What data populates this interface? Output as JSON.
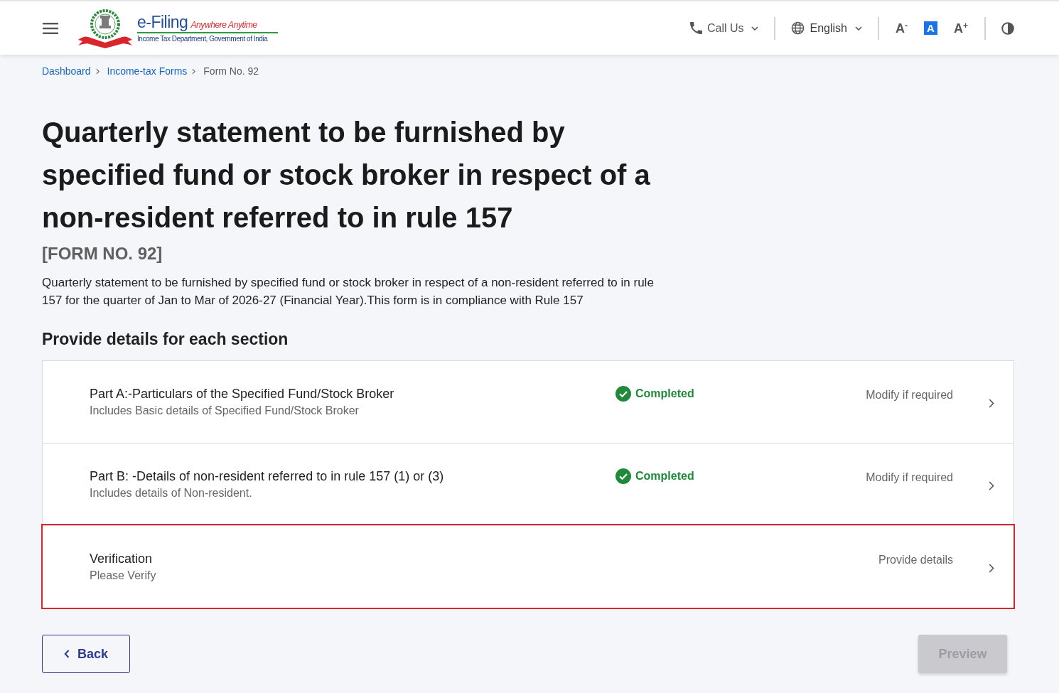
{
  "header": {
    "logo": {
      "title": "e-Filing",
      "tagline": "Anywhere Anytime",
      "subtitle": "Income Tax Department, Government of India"
    },
    "call_us": "Call Us",
    "language": "English",
    "text_size_options": [
      {
        "label": "A$^{-}$",
        "selected": false
      },
      {
        "label": "A",
        "selected": true
      },
      {
        "label": "A$^{+}$",
        "selected": false
      }
    ]
  },
  "breadcrumb": [
    {
      "label": "Dashboard",
      "current": false
    },
    {
      "label": "Income-tax Forms",
      "current": false
    },
    {
      "label": "Form No. 92",
      "current": true
    }
  ],
  "title": "Quarterly statement to be furnished by specified fund or stock broker in respect of a non-resident referred to in rule 157",
  "form_number": "[FORM NO. 92]",
  "description": "Quarterly statement to be furnished by specified fund or stock broker in respect of a non-resident referred to in rule 157 for the quarter of Jan to Mar of 2026-27 (Financial Year).This form is in compliance with Rule 157",
  "sections_heading": "Provide details for each section",
  "sections": [
    {
      "title": "Part A:-Particulars of the Specified Fund/Stock Broker",
      "subtitle": "Includes Basic details of Specified Fund/Stock Broker",
      "status": {
        "label": "Completed",
        "kind": "completed"
      },
      "action": "Modify if required",
      "highlighted": false
    },
    {
      "title": "Part B: -Details of non-resident referred to in rule 157 (1) or (3)",
      "subtitle": "Includes details of Non-resident.",
      "status": {
        "label": "Completed",
        "kind": "completed"
      },
      "action": "Modify if required",
      "highlighted": false
    },
    {
      "title": "Verification",
      "subtitle": "Please Verify",
      "action": "Provide details",
      "highlighted": true
    }
  ],
  "back_button": {
    "label": "Back"
  },
  "preview_button": {
    "label": "Preview",
    "disabled": true
  }
}
